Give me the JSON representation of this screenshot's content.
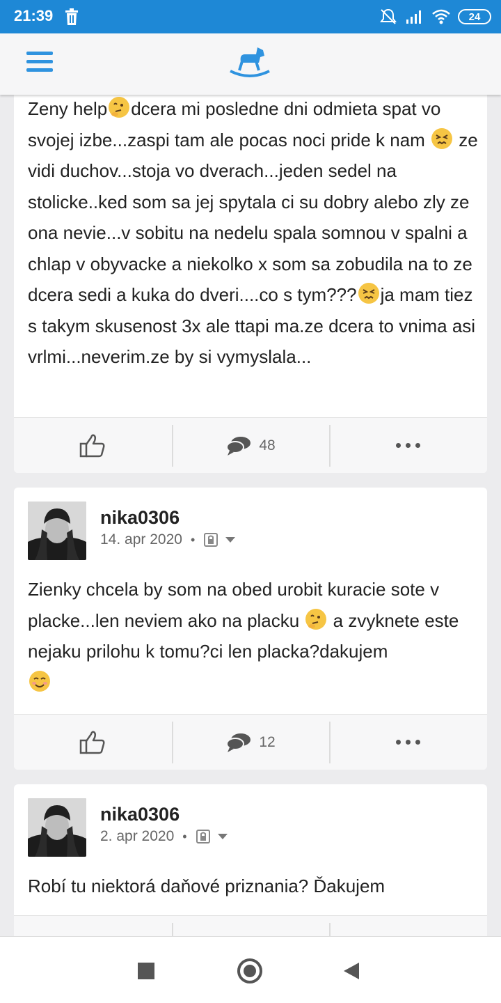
{
  "status_bar": {
    "time": "21:39",
    "battery": "24",
    "icons": [
      "trash-icon",
      "bell-muted-icon",
      "signal-icon",
      "wifi-icon",
      "battery-icon"
    ]
  },
  "app_bar": {
    "menu_icon": "hamburger-menu-icon",
    "logo_icon": "rocking-horse-logo"
  },
  "posts": [
    {
      "text_parts": [
        "Zeny help",
        "dcera mi posledne dni odmieta spat vo svojej izbe...zaspi tam ale pocas noci pride k nam ",
        " ze vidi duchov...stoja vo dverach...jeden sedel na stolicke..ked som sa jej spytala ci su dobry alebo zly ze ona nevie...v sobitu na nedelu spala somnou v spalni a chlap v obyvacke a niekolko x som sa zobudila na to ze dcera sedi a kuka do dveri....co s tym???",
        "ja mam tiez s takym skusenost 3x ale ttapi ma.ze dcera to vnima asi vrlmi...neverim.ze by si vymyslala..."
      ],
      "emojis": [
        "thinking-face-emoji",
        "persevering-face-emoji",
        "persevering-face-emoji"
      ],
      "comment_count": "48"
    },
    {
      "author": "nika0306",
      "date": "14. apr 2020",
      "text_parts": [
        "Zienky chcela by som na obed urobit kuracie sote v placke...len neviem ako na placku ",
        " a zvyknete este nejaku prilohu k tomu?ci len placka?dakujem"
      ],
      "emojis": [
        "thinking-face-emoji",
        "smiling-face-emoji"
      ],
      "comment_count": "12"
    },
    {
      "author": "nika0306",
      "date": "2. apr 2020",
      "text": "Robí tu niektorá daňové priznania? Ďakujem"
    }
  ],
  "colors": {
    "status_bar": "#1e88d6",
    "accent": "#2f93df",
    "page_bg": "#ececee"
  }
}
